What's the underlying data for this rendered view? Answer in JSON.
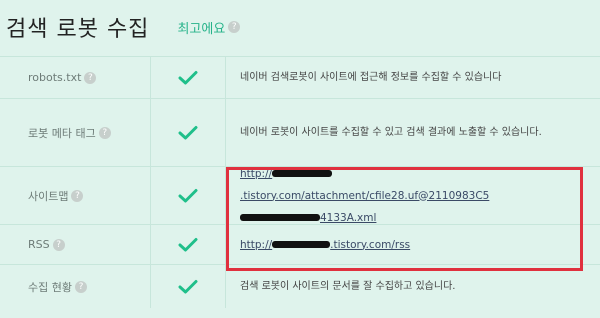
{
  "header": {
    "title": "검색 로봇 수집",
    "status_badge": "최고에요"
  },
  "rows": [
    {
      "name": "robots.txt",
      "description": "네이버 검색로봇이 사이트에 접근해 정보를 수집할 수 있습니다"
    },
    {
      "name": "로봇 메타 태그",
      "description": "네이버 로봇이 사이트를 수집할 수 있고 검색 결과에 노출할 수 있습니다."
    },
    {
      "name": "사이트맵",
      "link_line1_prefix": "http://",
      "link_line1_suffix": ".tistory.com/attachment/cfile28.uf@2110983C5",
      "link_line2_suffix": "4133A.xml"
    },
    {
      "name": "RSS",
      "link_prefix": "http://",
      "link_suffix": ".tistory.com/rss"
    },
    {
      "name": "수집 현황",
      "description": "검색 로봇이 사이트의 문서를 잘 수집하고 있습니다."
    }
  ],
  "colors": {
    "background": "#dff3ec",
    "accent_green": "#27b38a",
    "highlight_red": "#e0303e"
  },
  "icons": {
    "status": "check-icon",
    "help": "help-icon"
  }
}
